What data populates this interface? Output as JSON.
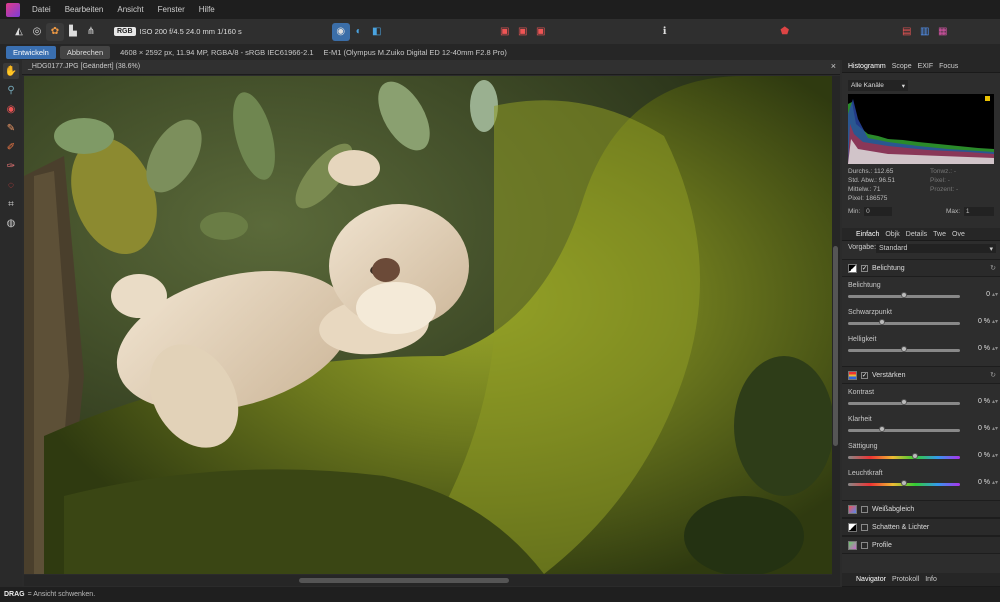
{
  "menu": [
    "Datei",
    "Bearbeiten",
    "Ansicht",
    "Fenster",
    "Hilfe"
  ],
  "toolbar": {
    "exif": "ISO 200 f/4.5 24.0 mm 1/160 s",
    "rgb": "RGB"
  },
  "subbar": {
    "develop": "Entwickeln",
    "cancel": "Abbrechen",
    "info": "4608 × 2592 px, 11.94 MP, RGBA/8 - sRGB IEC61966-2.1",
    "camera": "E-M1 (Olympus M.Zuiko Digital ED 12-40mm F2.8 Pro)"
  },
  "doc": {
    "title": "_HDG0177.JPG [Geändert] (38.6%)",
    "close": "×"
  },
  "status": {
    "key": "DRAG",
    "text": "= Ansicht schwenken."
  },
  "histogram": {
    "tabs": [
      "Histogramm",
      "Scope",
      "EXIF",
      "Focus"
    ],
    "channel": "Alle Kanäle",
    "stats": [
      {
        "label": "Durchs.:",
        "value": "112.65"
      },
      {
        "label": "Std. Abw.:",
        "value": "96.51"
      },
      {
        "label": "Mittelw.:",
        "value": "71"
      },
      {
        "label": "Pixel:",
        "value": "186575"
      }
    ],
    "stats_right": [
      "Tonwz.: -",
      "Pixel: -",
      "Prozent: -"
    ],
    "min_label": "Min:",
    "min_value": "0",
    "max_label": "Max:",
    "max_value": "1"
  },
  "develop": {
    "tabs": [
      "Einfach",
      "Objk",
      "Details",
      "Twe",
      "Ove"
    ],
    "preset_label": "Vorgabe:",
    "preset": "Standard",
    "exposure_section": "Belichtung",
    "exposure_sliders": [
      {
        "label": "Belichtung",
        "value": "0",
        "pos": 0.5
      },
      {
        "label": "Schwarzpunkt",
        "value": "0 %",
        "pos": 0.3
      },
      {
        "label": "Helligkeit",
        "value": "0 %",
        "pos": 0.5
      }
    ],
    "enhance_section": "Verstärken",
    "enhance_sliders": [
      {
        "label": "Kontrast",
        "value": "0 %",
        "pos": 0.5
      },
      {
        "label": "Klarheit",
        "value": "0 %",
        "pos": 0.3
      },
      {
        "label": "Sättigung",
        "value": "0 %",
        "pos": 0.6
      },
      {
        "label": "Leuchtkraft",
        "value": "0 %",
        "pos": 0.5
      }
    ],
    "sections": [
      "Weißabgleich",
      "Schatten & Lichter",
      "Profile"
    ]
  },
  "bottom_tabs": [
    "Navigator",
    "Protokoll",
    "Info"
  ]
}
